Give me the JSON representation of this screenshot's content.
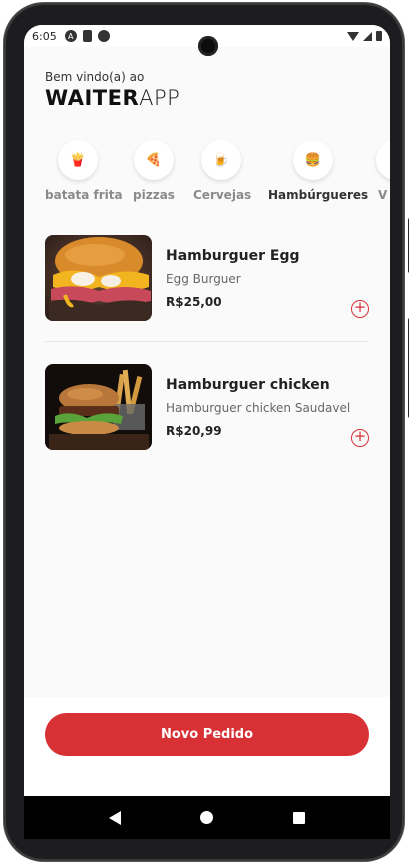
{
  "status_bar": {
    "time": "6:05",
    "icons": [
      "android-icon",
      "sd-card-icon",
      "data-saver-icon",
      "wifi-icon",
      "signal-icon",
      "battery-icon"
    ]
  },
  "header": {
    "welcome": "Bem vindo(a) ao",
    "brand_bold": "WAITER",
    "brand_light": "APP"
  },
  "categories": [
    {
      "icon": "🍟",
      "icon_name": "fries-icon",
      "label": "batata frita",
      "active": false
    },
    {
      "icon": "🍕",
      "icon_name": "pizza-icon",
      "label": "pizzas",
      "active": false
    },
    {
      "icon": "🍺",
      "icon_name": "beer-icon",
      "label": "Cervejas",
      "active": false
    },
    {
      "icon": "🍔",
      "icon_name": "burger-icon",
      "label": "Hambúrgueres",
      "active": true
    },
    {
      "icon": "",
      "icon_name": "more-category-icon",
      "label": "V",
      "active": false
    }
  ],
  "products": [
    {
      "name": "Hamburguer Egg",
      "description": "Egg Burguer",
      "price": "R$25,00"
    },
    {
      "name": "Hamburguer chicken",
      "description": "Hamburguer chicken Saudavel",
      "price": "R$20,99"
    }
  ],
  "footer": {
    "order_button": "Novo Pedido"
  },
  "colors": {
    "accent": "#d73035",
    "background": "#fafafa"
  }
}
